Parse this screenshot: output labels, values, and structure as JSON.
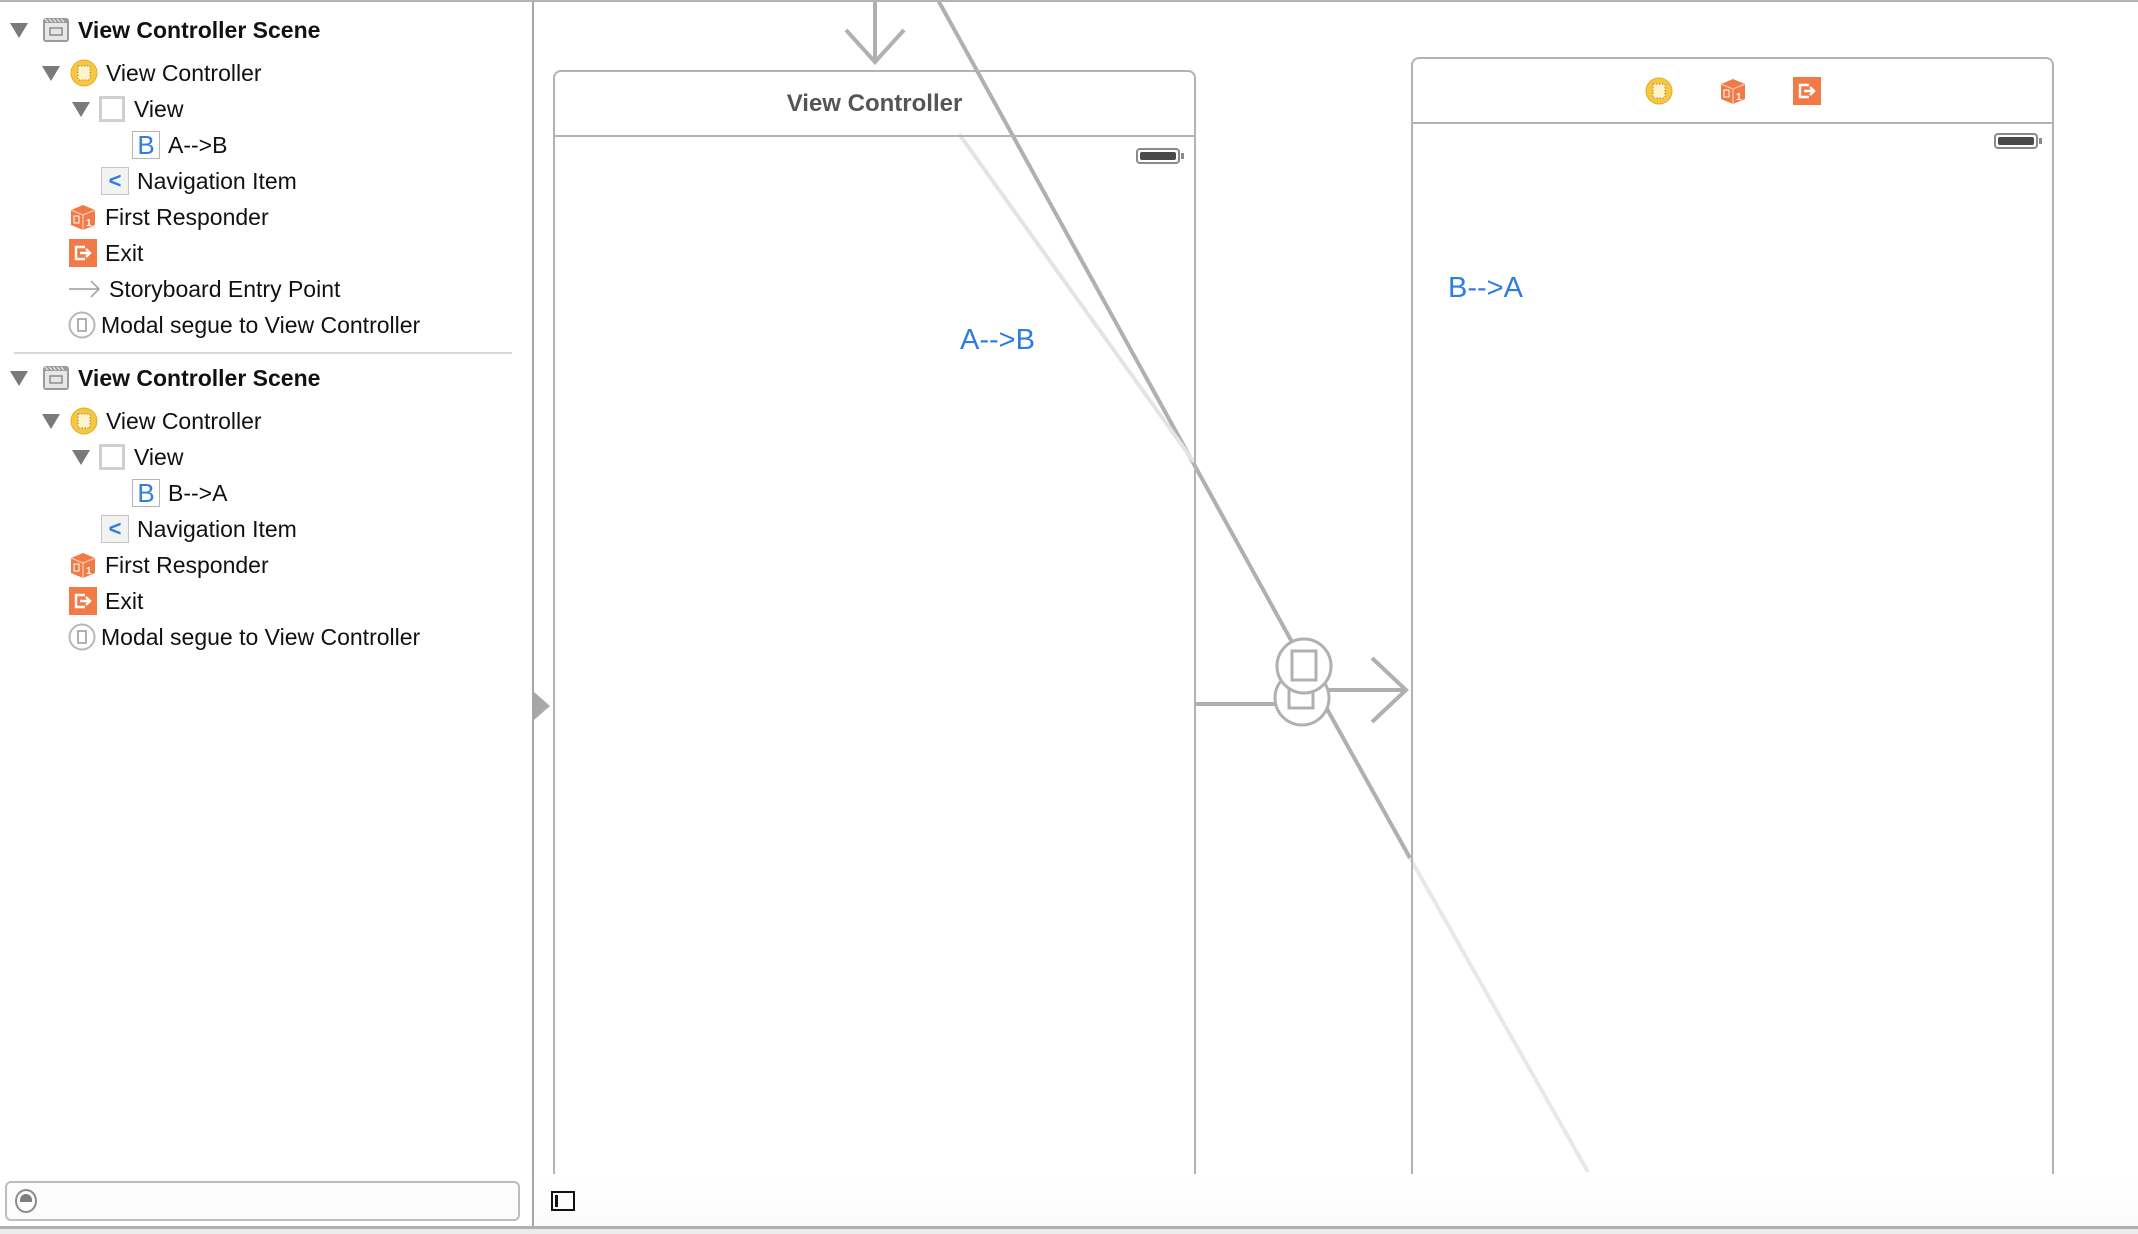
{
  "outline": {
    "scenes": [
      {
        "title": "View Controller Scene",
        "items": [
          {
            "label": "View Controller",
            "icon": "view-controller-icon",
            "level": 1,
            "expanded": true
          },
          {
            "label": "View",
            "icon": "view-icon",
            "level": 2,
            "expanded": true
          },
          {
            "label": "A-->B",
            "icon": "button-icon",
            "level": 3
          },
          {
            "label": "Navigation Item",
            "icon": "navigation-item-icon",
            "level": 2
          },
          {
            "label": "First Responder",
            "icon": "first-responder-icon",
            "level": 1
          },
          {
            "label": "Exit",
            "icon": "exit-icon",
            "level": 1
          },
          {
            "label": "Storyboard Entry Point",
            "icon": "entry-point-arrow-icon",
            "level": 1
          },
          {
            "label": "Modal segue to View Controller",
            "icon": "modal-segue-icon",
            "level": 1
          }
        ]
      },
      {
        "title": "View Controller Scene",
        "items": [
          {
            "label": "View Controller",
            "icon": "view-controller-icon",
            "level": 1,
            "expanded": true
          },
          {
            "label": "View",
            "icon": "view-icon",
            "level": 2,
            "expanded": true
          },
          {
            "label": "B-->A",
            "icon": "button-icon",
            "level": 3
          },
          {
            "label": "Navigation Item",
            "icon": "navigation-item-icon",
            "level": 2
          },
          {
            "label": "First Responder",
            "icon": "first-responder-icon",
            "level": 1
          },
          {
            "label": "Exit",
            "icon": "exit-icon",
            "level": 1
          },
          {
            "label": "Modal segue to View Controller",
            "icon": "modal-segue-icon",
            "level": 1
          }
        ]
      }
    ],
    "button_glyph": "B",
    "nav_glyph": "<",
    "filter": {
      "value": "",
      "placeholder": ""
    }
  },
  "canvas": {
    "scene_a": {
      "title": "View Controller",
      "button_label": "A-->B"
    },
    "scene_b": {
      "title": "",
      "button_label": "B-->A",
      "dock_icons": [
        "view-controller-icon",
        "first-responder-icon",
        "exit-icon"
      ]
    }
  },
  "colors": {
    "accent_blue": "#2f7de1",
    "vc_yellow": "#f6c842",
    "responder_orange": "#f27a46",
    "line_gray": "#b3b3b3"
  }
}
